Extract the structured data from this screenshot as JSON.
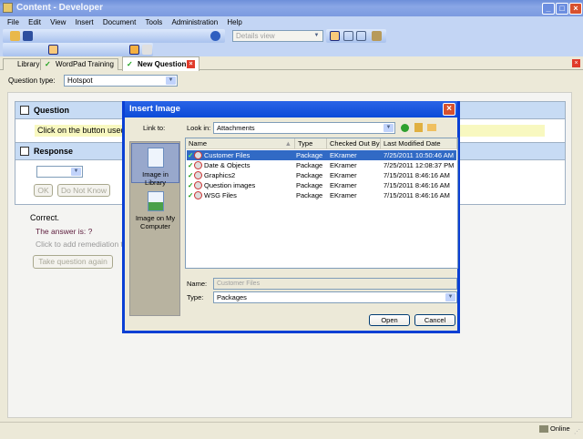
{
  "window": {
    "title": "Content - Developer"
  },
  "menu": [
    "File",
    "Edit",
    "View",
    "Insert",
    "Document",
    "Tools",
    "Administration",
    "Help"
  ],
  "toolbar": {
    "view_select": "Details view"
  },
  "tabs": [
    {
      "label": "Library"
    },
    {
      "label": "WordPad Training"
    },
    {
      "label": "New Question"
    }
  ],
  "question_type": {
    "label": "Question type:",
    "value": "Hotspot"
  },
  "question": {
    "header": "Question",
    "text": "Click on the button used t"
  },
  "response": {
    "header": "Response",
    "ok": "OK",
    "do_not_know": "Do Not Know"
  },
  "feedback": {
    "correct": "Correct.",
    "answer": "The answer is: ?",
    "remediation": "Click to add remediation te",
    "retry": "Take question again"
  },
  "dialog": {
    "title": "Insert Image",
    "link_to_label": "Link to:",
    "link_items": [
      "Image in Library",
      "Image on My Computer"
    ],
    "look_in_label": "Look in:",
    "look_in_value": "Attachments",
    "columns": [
      "Name",
      "Type",
      "Checked Out By",
      "Last Modified Date"
    ],
    "rows": [
      {
        "name": "Customer Files",
        "type": "Package",
        "checked_out_by": "EKramer",
        "modified": "7/25/2011 10:50:46 AM"
      },
      {
        "name": "Date & Objects",
        "type": "Package",
        "checked_out_by": "EKramer",
        "modified": "7/25/2011 12:08:37 PM"
      },
      {
        "name": "Graphics2",
        "type": "Package",
        "checked_out_by": "EKramer",
        "modified": "7/15/2011 8:46:16 AM"
      },
      {
        "name": "Question images",
        "type": "Package",
        "checked_out_by": "EKramer",
        "modified": "7/15/2011 8:46:16 AM"
      },
      {
        "name": "WSG Files",
        "type": "Package",
        "checked_out_by": "EKramer",
        "modified": "7/15/2011 8:46:16 AM"
      }
    ],
    "name_label": "Name:",
    "name_value": "Customer Files",
    "type_label": "Type:",
    "type_value": "Packages",
    "open": "Open",
    "cancel": "Cancel"
  },
  "status": {
    "text": "Online"
  }
}
